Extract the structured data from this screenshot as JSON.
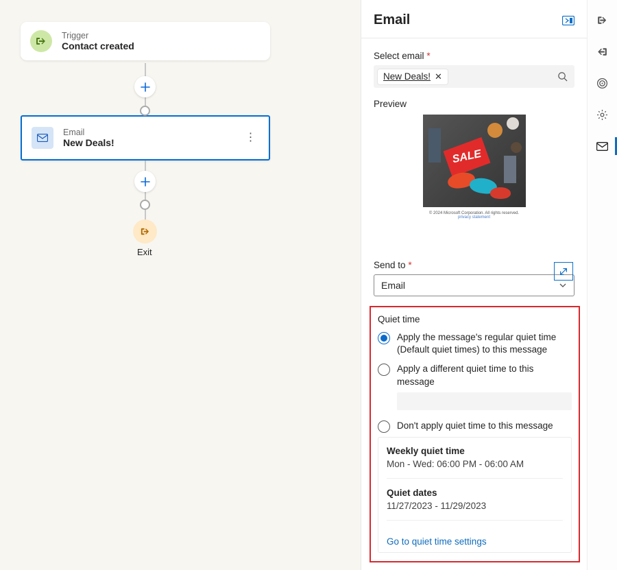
{
  "canvas": {
    "trigger": {
      "subtitle": "Trigger",
      "title": "Contact created"
    },
    "email_node": {
      "subtitle": "Email",
      "title": "New Deals!"
    },
    "exit_label": "Exit"
  },
  "panel": {
    "title": "Email",
    "select_email_label": "Select email",
    "selected_chip": "New Deals!",
    "preview_label": "Preview",
    "preview_sale_text": "SALE",
    "preview_caption_line1": "© 2024 Microsoft Corporation. All rights reserved.",
    "preview_caption_line2": "privacy statement",
    "send_to_label": "Send to",
    "send_to_value": "Email",
    "quiet": {
      "section_title": "Quiet time",
      "opt1": "Apply the message's regular quiet time (Default quiet times) to this message",
      "opt2": "Apply a different quiet time to this message",
      "opt3": "Don't apply quiet time to this message",
      "weekly_title": "Weekly quiet time",
      "weekly_value": "Mon - Wed: 06:00 PM - 06:00 AM",
      "dates_title": "Quiet dates",
      "dates_value": "11/27/2023 - 11/29/2023",
      "settings_link": "Go to quiet time settings"
    }
  }
}
